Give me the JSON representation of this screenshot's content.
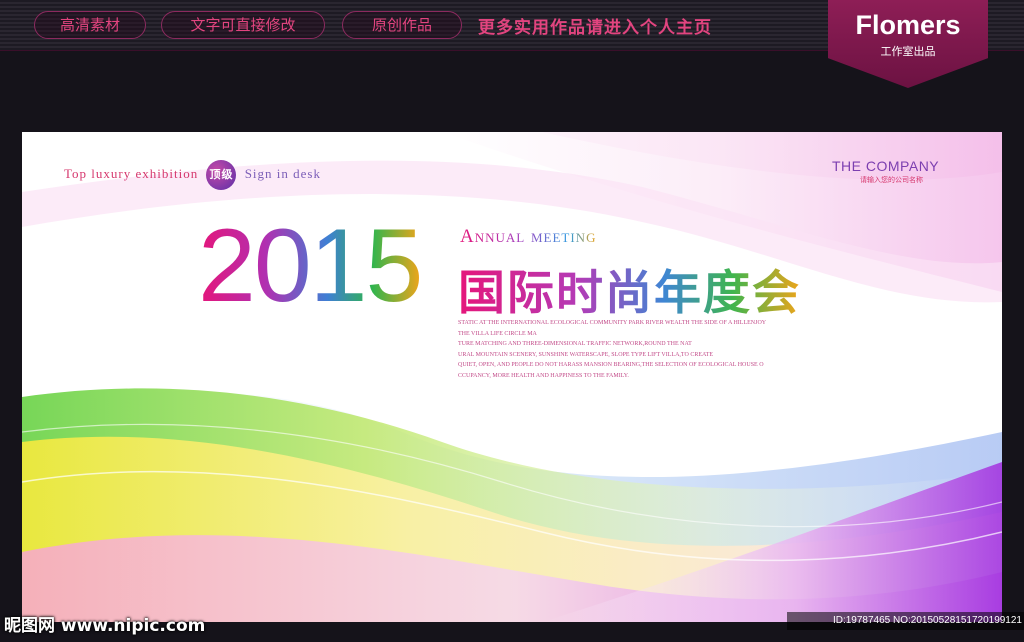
{
  "topbar": {
    "pills": [
      "高清素材",
      "文字可直接修改",
      "原创作品"
    ],
    "promo": "更多实用作品请进入个人主页"
  },
  "brand": {
    "name": "Flomers",
    "subtitle": "工作室出品",
    "color": "#8e1e56"
  },
  "poster": {
    "tagline_parts": [
      "Top",
      "luxury",
      "exhibition",
      "Sign",
      "in",
      "desk"
    ],
    "tagline_part1": "Top luxury exhibition",
    "badge": "顶级",
    "tagline_part2": "Sign in desk",
    "company": "THE COMPANY",
    "company_sub": "请输入您的公司名称",
    "year": "2015",
    "annual": "Annual meeting",
    "cn_title": "国际时尚年度会",
    "description": [
      "STATIC AT THE INTERNATIONAL ECOLOGICAL COMMUNITY PARK RIVER WEALTH THE SIDE OF A HILLENJOY",
      "THE VILLA LIFE CIRCLE MA",
      "TURE MATCHING AND THREE-DIMENSIONAL TRAFFIC NETWORK,ROUND THE NAT",
      "URAL MOUNTAIN SCENERY, SUNSHINE WATERSCAPE, SLOPE TYPE LIFT VILLA,TO CREATE",
      "QUIET, OPEN, AND PEOPLE DO NOT HARASS MANSION BEARING,THE SELECTION OF ECOLOGICAL HOUSE O",
      "CCUPANCY, MORE HEALTH AND HAPPINESS TO THE FAMILY."
    ]
  },
  "watermark": {
    "left": "昵图网 www.nipic.com",
    "right": "ID:19787465 NO:20150528151720199121"
  },
  "colors": {
    "background": "#15131a",
    "accent_pink": "#e2447f",
    "gradient": [
      "#e5167a",
      "#b43bb6",
      "#3f86d4",
      "#3fb54e",
      "#f0a41a"
    ]
  }
}
